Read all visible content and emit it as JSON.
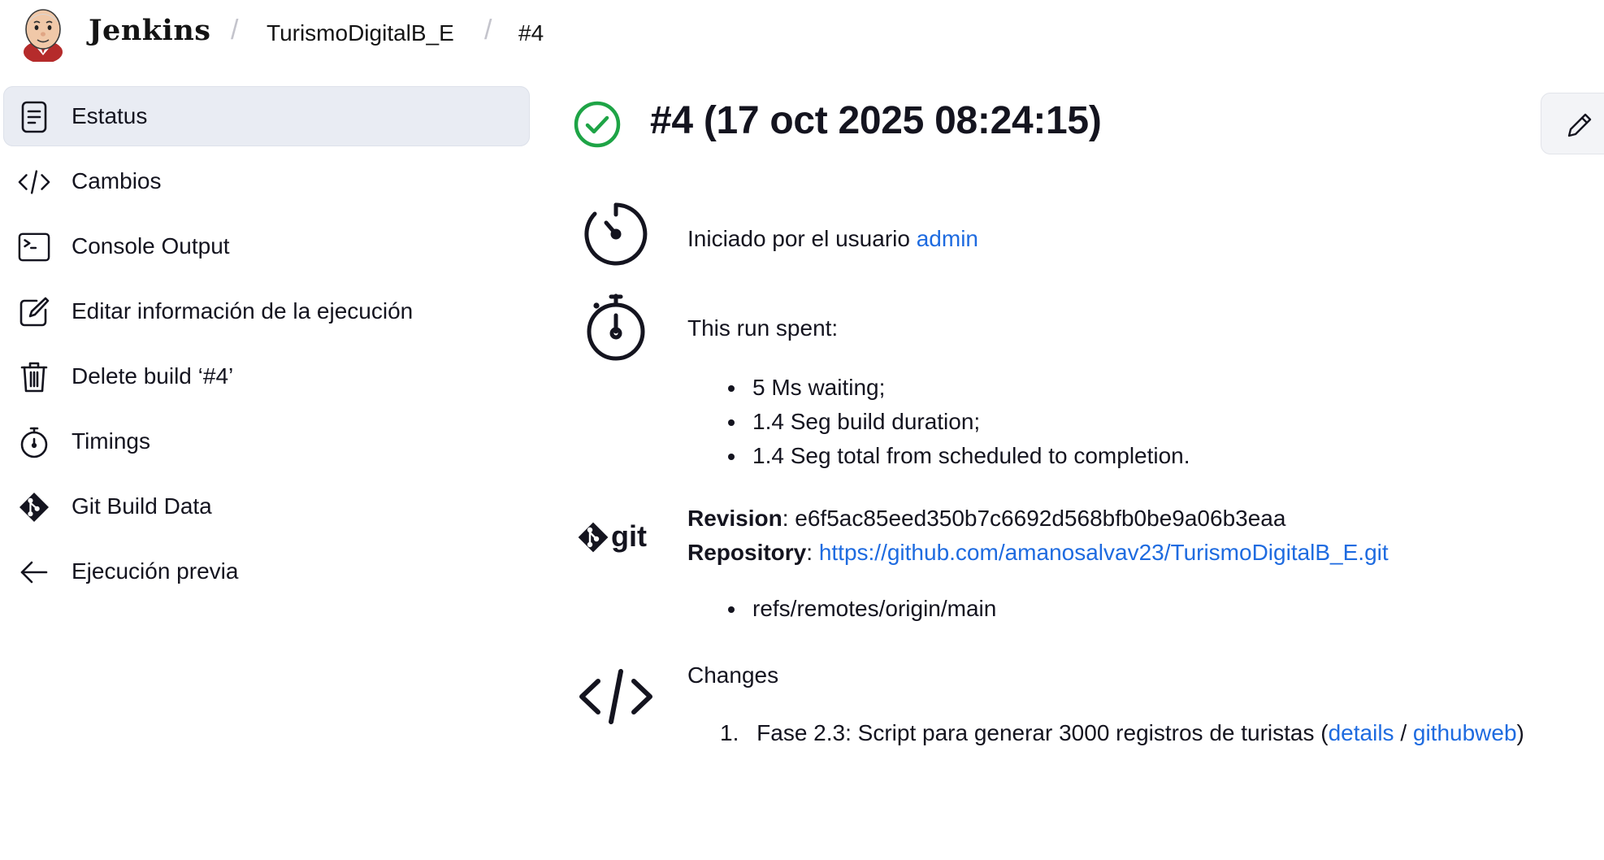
{
  "header": {
    "brand": "Jenkins",
    "breadcrumbs": [
      {
        "label": "TurismoDigitalB_E"
      },
      {
        "label": "#4"
      }
    ]
  },
  "sidebar": {
    "items": [
      {
        "label": "Estatus",
        "icon": "document-icon",
        "active": true
      },
      {
        "label": "Cambios",
        "icon": "code-icon"
      },
      {
        "label": "Console Output",
        "icon": "terminal-icon"
      },
      {
        "label": "Editar información de la ejecución",
        "icon": "edit-icon"
      },
      {
        "label": "Delete build ‘#4’",
        "icon": "trash-icon"
      },
      {
        "label": "Timings",
        "icon": "stopwatch-icon"
      },
      {
        "label": "Git Build Data",
        "icon": "git-icon"
      },
      {
        "label": "Ejecución previa",
        "icon": "arrow-left-icon"
      }
    ]
  },
  "build": {
    "title": "#4 (17 oct 2025 08:24:15)",
    "status": "success",
    "status_color": "#1ea446",
    "started_by_prefix": "Iniciado por el usuario",
    "started_by_user": "admin",
    "timing": {
      "heading": "This run spent:",
      "items": [
        "5 Ms waiting;",
        "1.4 Seg build duration;",
        "1.4 Seg total from scheduled to completion."
      ]
    },
    "git": {
      "logo_text": "git",
      "revision_label": "Revision",
      "revision": "e6f5ac85eed350b7c6692d568bfb0be9a06b3eaa",
      "repository_label": "Repository",
      "repository_url": "https://github.com/amanosalvav23/TurismoDigitalB_E.git",
      "refs": [
        "refs/remotes/origin/main"
      ]
    },
    "changes": {
      "heading": "Changes",
      "items": [
        {
          "number": "1.",
          "message": "Fase 2.3: Script para generar 3000 registros de turistas (",
          "details_link": "details",
          "separator": " / ",
          "web_link": "githubweb",
          "suffix": ")"
        }
      ]
    }
  },
  "colors": {
    "link": "#1e6be0",
    "active_background": "#e9ecf3",
    "text": "#14141f"
  }
}
